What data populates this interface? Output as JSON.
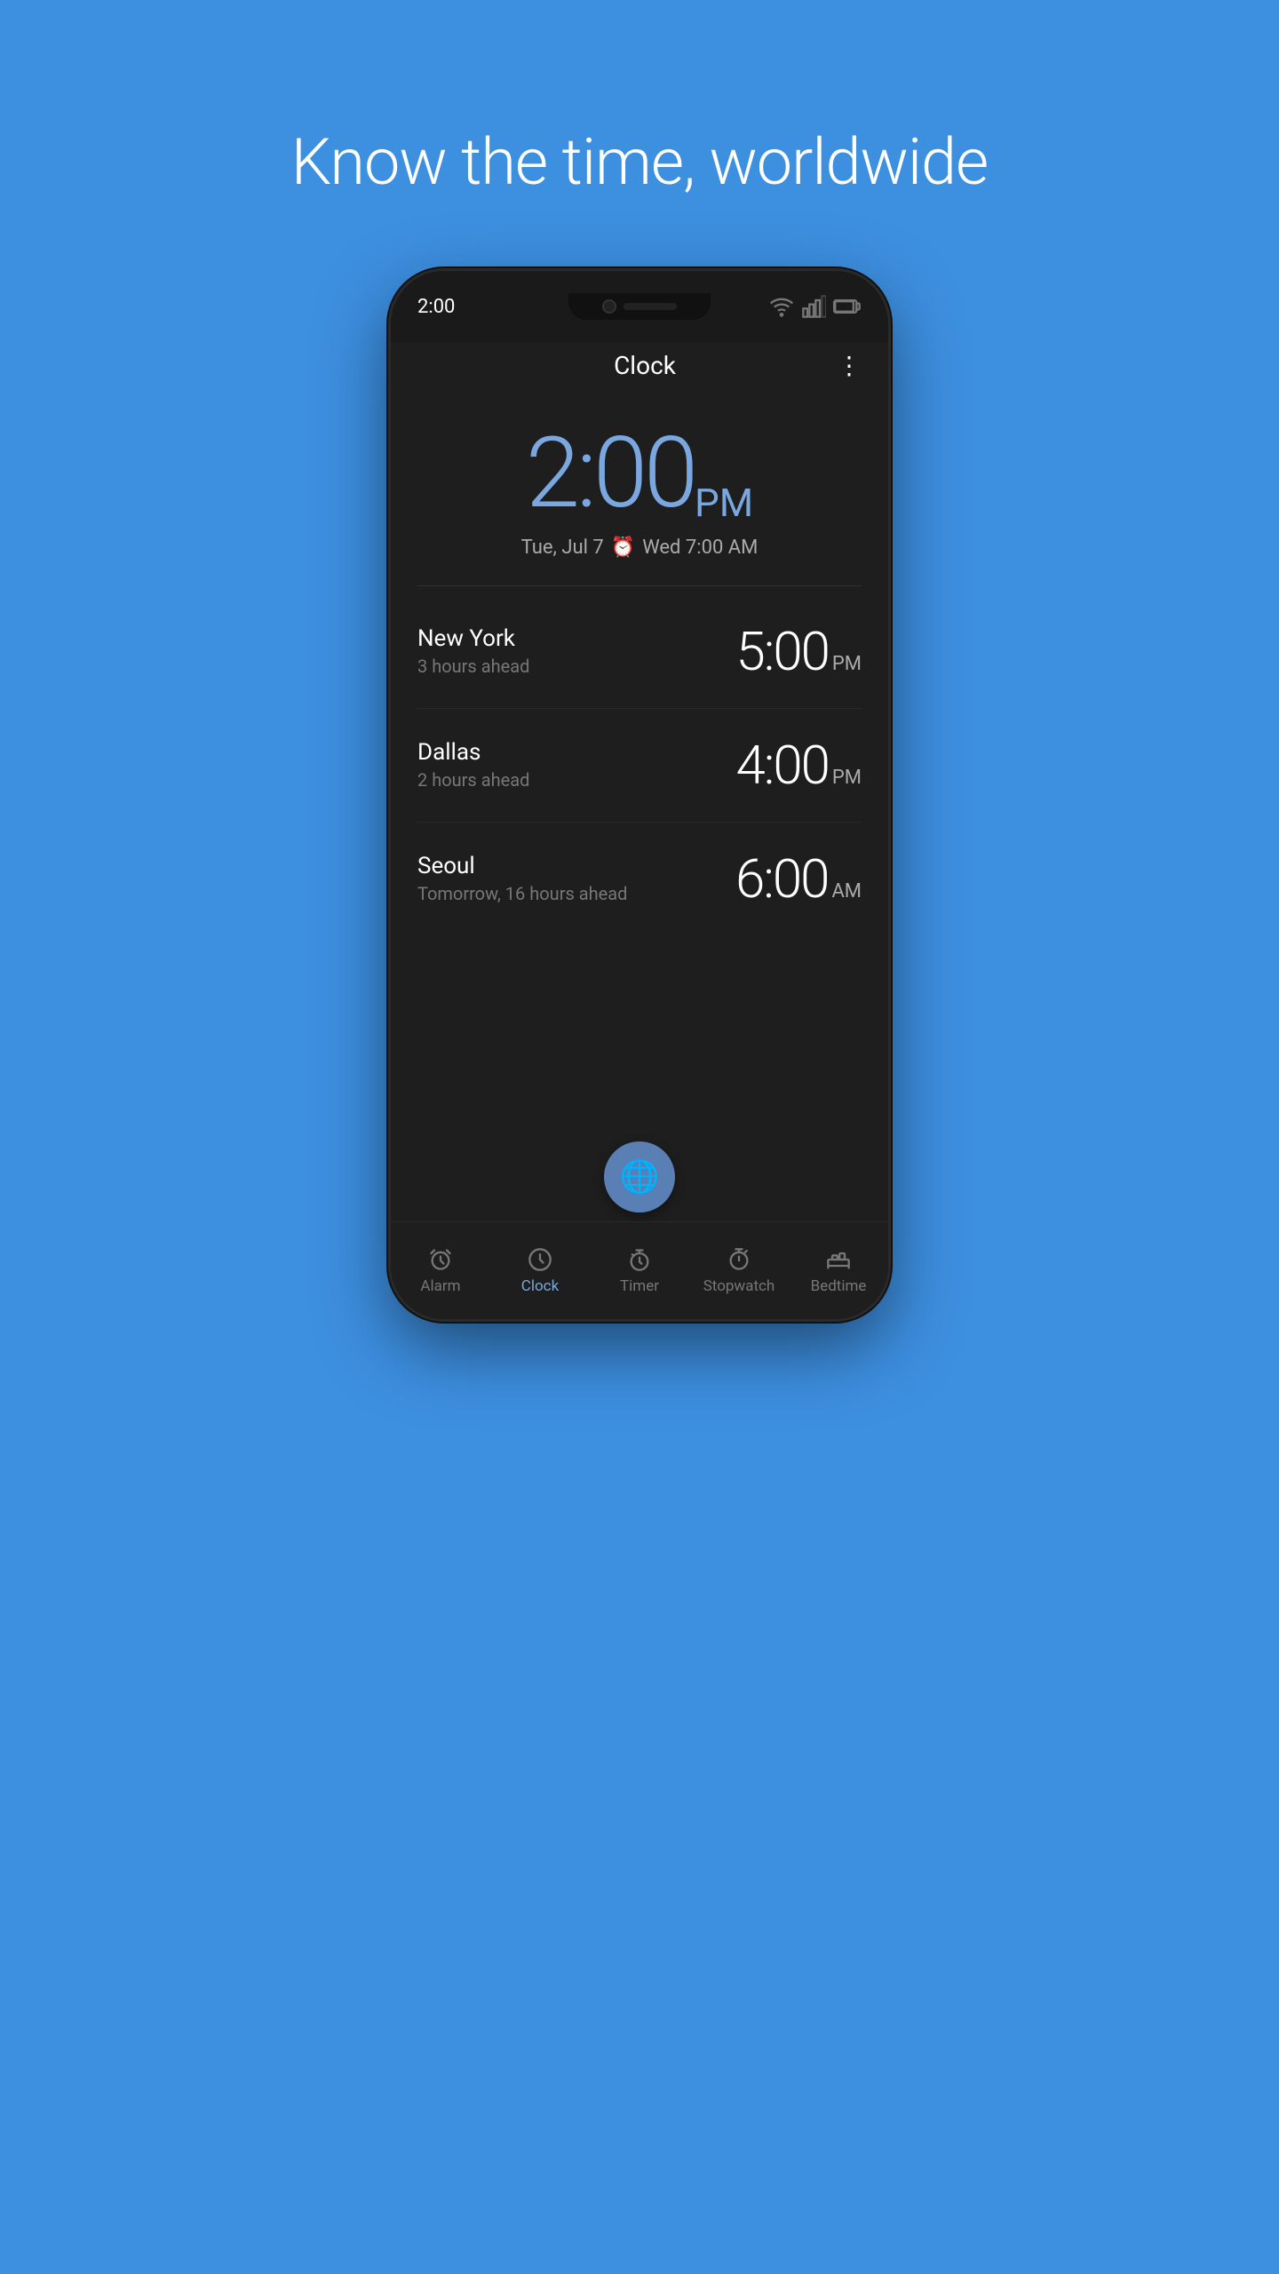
{
  "hero": {
    "tagline": "Know the time, worldwide"
  },
  "phone": {
    "statusBar": {
      "time": "2:00",
      "wifi": "wifi",
      "signal": "signal",
      "battery": "battery"
    },
    "appBar": {
      "title": "Clock",
      "moreMenu": "⋮"
    },
    "mainClock": {
      "time": "2:00",
      "ampm": "PM",
      "date": "Tue, Jul 7",
      "alarmDate": "Wed 7:00 AM"
    },
    "worldClocks": [
      {
        "city": "New York",
        "offset": "3 hours ahead",
        "time": "5:00",
        "ampm": "PM"
      },
      {
        "city": "Dallas",
        "offset": "2 hours ahead",
        "time": "4:00",
        "ampm": "PM"
      },
      {
        "city": "Seoul",
        "offset": "Tomorrow, 16 hours ahead",
        "time": "6:00",
        "ampm": "AM"
      }
    ],
    "fab": {
      "icon": "🌐"
    },
    "bottomNav": [
      {
        "id": "alarm",
        "label": "Alarm",
        "active": false
      },
      {
        "id": "clock",
        "label": "Clock",
        "active": true
      },
      {
        "id": "timer",
        "label": "Timer",
        "active": false
      },
      {
        "id": "stopwatch",
        "label": "Stopwatch",
        "active": false
      },
      {
        "id": "bedtime",
        "label": "Bedtime",
        "active": false
      }
    ]
  }
}
